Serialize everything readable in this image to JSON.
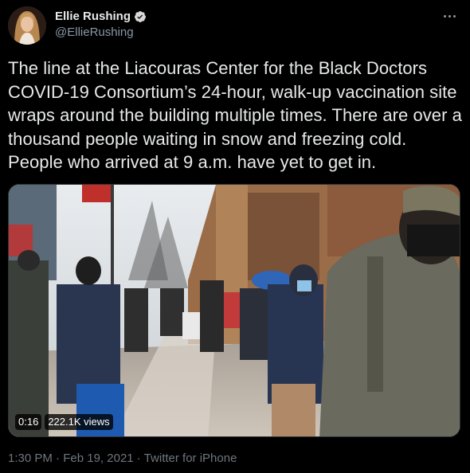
{
  "author": {
    "display_name": "Ellie Rushing",
    "handle": "@EllieRushing",
    "verified": true,
    "avatar_icon": "avatar-photo"
  },
  "more_icon": "more-horizontal-icon",
  "tweet": {
    "text": "The line at the Liacouras Center for the Black Doctors COVID-19 Consortium’s 24-hour, walk-up vaccination site wraps around the building multiple times. There are over a thousand people waiting in snow and freezing cold. People who arrived at 9 a.m. have yet to get in."
  },
  "video": {
    "duration": "0:16",
    "views": "222.1K views",
    "description_icon": "video-thumbnail"
  },
  "meta": {
    "time": "1:30 PM",
    "separator": " · ",
    "date": "Feb 19, 2021",
    "source": "Twitter for iPhone"
  },
  "colors": {
    "background": "#000000",
    "text": "#e7e9ea",
    "secondary": "#6e767d",
    "verified": "#d9d9d9"
  }
}
